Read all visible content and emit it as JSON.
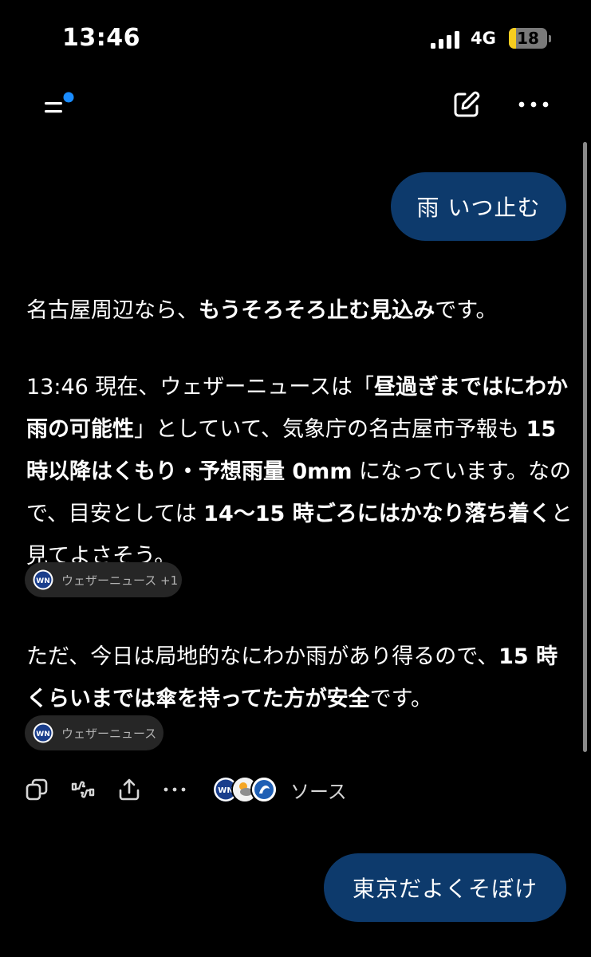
{
  "status_bar": {
    "time": "13:46",
    "network": "4G",
    "battery_level": "18",
    "battery_fraction": 0.18
  },
  "topbar": {
    "menu_icon": "menu-with-notification-dot-icon",
    "compose_icon": "compose-icon",
    "more_icon": "more-horizontal-icon",
    "accent_color": "#1a8cff"
  },
  "conversation": {
    "user_message_1": "雨 いつ止む",
    "answer": {
      "p1": {
        "s1": "名古屋周辺なら、",
        "s2": "もうそろそろ止む見込み",
        "s3": "です。"
      },
      "p2": {
        "s1": "13:46 現在、ウェザーニュースは「",
        "s2": "昼過ぎまではにわか雨の可能性",
        "s3": "」としていて、気象庁の名古屋市予報も ",
        "s4": "15 時以降はくもり・予想雨量 0mm",
        "s5": " になっています。なので、目安としては ",
        "s6": "14〜15 時ごろにはかなり落ち着く",
        "s7": "と見てよさそう。"
      },
      "chip_1": "ウェザーニュース +1",
      "p3": {
        "s1": "ただ、今日は局地的なにわか雨があり得るので、",
        "s2": "15 時くらいまでは傘を持ってた方が安全",
        "s3": "です。"
      },
      "chip_2": "ウェザーニュース"
    },
    "actions": {
      "copy_icon": "copy-icon",
      "feedback_icon": "thumbs-up-down-icon",
      "share_icon": "share-icon",
      "more_icon": "more-horizontal-icon",
      "sources_label": "ソース"
    },
    "user_message_2": "東京だよくそぼけ"
  },
  "colors": {
    "background": "#000000",
    "bubble": "#0d3a6c",
    "chip": "#262626",
    "battery_fill": "#f7cd1f"
  }
}
